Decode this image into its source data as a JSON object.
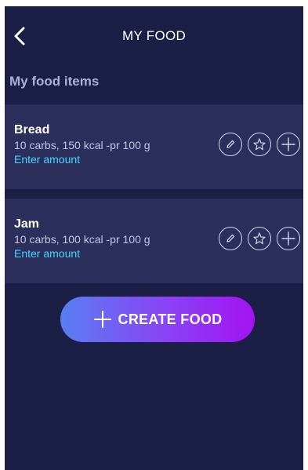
{
  "header": {
    "title": "MY FOOD",
    "back_icon": "chevron-left-icon"
  },
  "section": {
    "title": "My food items"
  },
  "items": [
    {
      "name": "Bread",
      "details": "10 carbs, 150 kcal -pr 100 g",
      "amount_label": "Enter amount"
    },
    {
      "name": "Jam",
      "details": "10 carbs, 100 kcal -pr 100 g",
      "amount_label": "Enter amount"
    }
  ],
  "actions": {
    "edit_icon": "pencil-icon",
    "favorite_icon": "star-icon",
    "add_icon": "plus-icon"
  },
  "create_button": {
    "label": "CREATE FOOD",
    "icon": "plus-icon"
  },
  "colors": {
    "background": "#1c1f45",
    "card": "#2c2f5c",
    "section_title": "#aab1d8",
    "accent_link": "#45d6ff",
    "button_gradient_start": "#5a7ef2",
    "button_gradient_end": "#a313f2"
  }
}
